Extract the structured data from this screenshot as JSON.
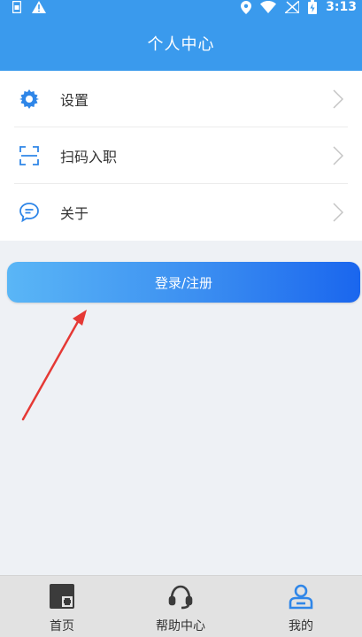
{
  "status_bar": {
    "time": "3:13",
    "icons": [
      "sim-icon",
      "warning-icon",
      "location-icon",
      "wifi-icon",
      "no-signal-icon",
      "battery-charging-icon"
    ]
  },
  "header": {
    "title": "个人中心"
  },
  "menu": {
    "items": [
      {
        "label": "设置",
        "icon": "gear-icon"
      },
      {
        "label": "扫码入职",
        "icon": "scan-icon"
      },
      {
        "label": "关于",
        "icon": "chat-bubble-icon"
      }
    ]
  },
  "login_button": {
    "label": "登录/注册"
  },
  "bottom_nav": {
    "items": [
      {
        "label": "首页",
        "icon": "home-grid-icon"
      },
      {
        "label": "帮助中心",
        "icon": "headset-icon"
      },
      {
        "label": "我的",
        "icon": "user-icon",
        "active": true
      }
    ]
  },
  "colors": {
    "header_bg": "#3a9aed",
    "accent": "#2f86e8",
    "page_bg": "#eef1f5",
    "nav_bg": "#e2e2e2",
    "annotation_arrow": "#e53935"
  }
}
